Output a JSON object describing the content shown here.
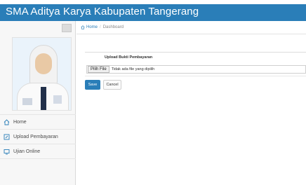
{
  "header": {
    "title": "SMA Aditya Karya Kabupaten Tangerang",
    "colors": {
      "topbar": "#2a7eb8"
    }
  },
  "sidebar": {
    "items": [
      {
        "label": "Home",
        "icon": "home-icon"
      },
      {
        "label": "Upload Pembayaran",
        "icon": "upload-icon"
      },
      {
        "label": "Ujian Online",
        "icon": "monitor-icon"
      }
    ]
  },
  "breadcrumb": {
    "home": "Home",
    "separator": "/",
    "current": "Dashboard"
  },
  "form": {
    "heading": "Upload Bukti Pembayaran",
    "file_button": "Pilih File",
    "file_status": "Tidak ada file yang dipilih",
    "save_label": "Save",
    "cancel_label": "Cancel"
  }
}
